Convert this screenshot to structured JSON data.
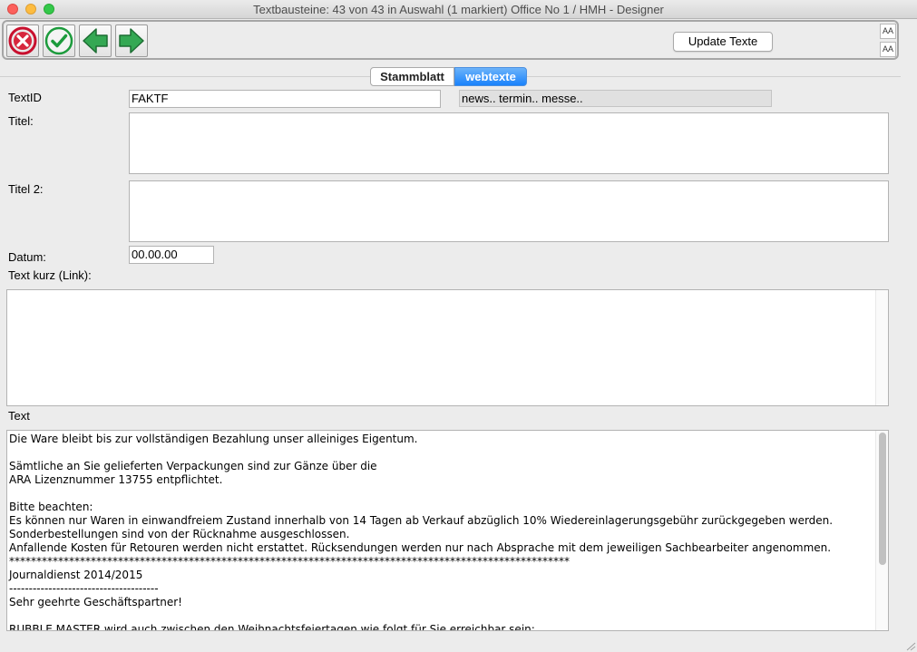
{
  "window": {
    "title": "Textbausteine: 43 von 43 in Auswahl  (1 markiert) Office No 1 /  HMH - Designer"
  },
  "toolbar": {
    "cancel_icon": "cancel-circle-icon",
    "ok_icon": "check-circle-icon",
    "prev_icon": "arrow-left-icon",
    "next_icon": "arrow-right-icon",
    "update_label": "Update Texte",
    "font_bigger_label": "AA",
    "font_smaller_label": "AA"
  },
  "tabs": [
    {
      "label": "Stammblatt",
      "active": false
    },
    {
      "label": "webtexte",
      "active": true
    }
  ],
  "form": {
    "textid_label": "TextID",
    "textid_value": "FAKTF",
    "category_value": "news.. termin.. messe..",
    "titel_label": "Titel:",
    "titel_value": "",
    "titel2_label": "Titel 2:",
    "titel2_value": "",
    "datum_label": "Datum:",
    "datum_value": "00.00.00",
    "textkurz_label": "Text kurz (Link):",
    "textkurz_value": "",
    "text_label": "Text",
    "text_value": "Die Ware bleibt bis zur vollständigen Bezahlung unser alleiniges Eigentum.\n\nSämtliche an Sie gelieferten Verpackungen sind zur Gänze über die\nARA Lizenznummer 13755 entpflichtet.\n\nBitte beachten:\nEs können nur Waren in einwandfreiem Zustand innerhalb von 14 Tagen ab Verkauf abzüglich 10% Wiedereinlagerungsgebühr zurückgegeben werden.\nSonderbestellungen sind von der Rücknahme ausgeschlossen.\nAnfallende Kosten für Retouren werden nicht erstattet. Rücksendungen werden nur nach Absprache mit dem jeweiligen Sachbearbeiter angenommen.\n*******************************************************************************************************\nJournaldienst 2014/2015\n--------------------------------------\nSehr geehrte Geschäftspartner!\n\nRUBBLE MASTER wird auch zwischen den Weihnachtsfeiertagen wie folgt für Sie erreichbar sein:"
  },
  "colors": {
    "tab_active": "#1a82fb",
    "window_bg": "#ececec"
  }
}
